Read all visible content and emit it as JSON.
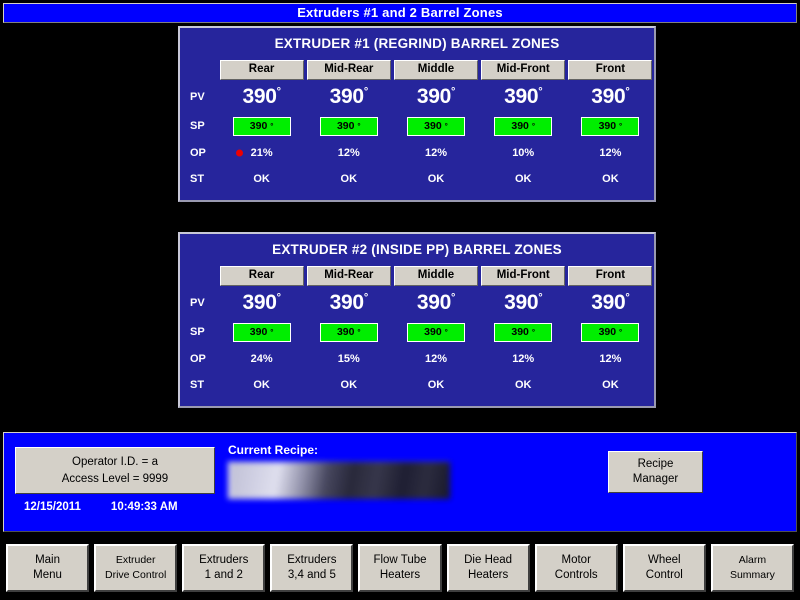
{
  "window": {
    "title": "Extruders #1 and 2 Barrel Zones",
    "title_bg": "#0000ff",
    "app_bg": "#000000",
    "panel_bg": "#26259c",
    "button_face": "#d4d0c8",
    "sp_green": "#00ee00",
    "alarm_red": "#ee0000"
  },
  "row_labels": {
    "pv": "PV",
    "sp": "SP",
    "op": "OP",
    "st": "ST"
  },
  "panels": [
    {
      "title": "EXTRUDER #1 (REGRIND) BARREL ZONES",
      "zones": [
        "Rear",
        "Mid-Rear",
        "Middle",
        "Mid-Front",
        "Front"
      ],
      "pv": [
        "390",
        "390",
        "390",
        "390",
        "390"
      ],
      "pv_unit": "°",
      "sp": [
        "390",
        "390",
        "390",
        "390",
        "390"
      ],
      "sp_unit": "°",
      "op": [
        "21%",
        "12%",
        "12%",
        "10%",
        "12%"
      ],
      "op_alarm": [
        true,
        false,
        false,
        false,
        false
      ],
      "st": [
        "OK",
        "OK",
        "OK",
        "OK",
        "OK"
      ]
    },
    {
      "title": "EXTRUDER #2 (INSIDE PP) BARREL ZONES",
      "zones": [
        "Rear",
        "Mid-Rear",
        "Middle",
        "Mid-Front",
        "Front"
      ],
      "pv": [
        "390",
        "390",
        "390",
        "390",
        "390"
      ],
      "pv_unit": "°",
      "sp": [
        "390",
        "390",
        "390",
        "390",
        "390"
      ],
      "sp_unit": "°",
      "op": [
        "24%",
        "15%",
        "12%",
        "12%",
        "12%"
      ],
      "op_alarm": [
        false,
        false,
        false,
        false,
        false
      ],
      "st": [
        "OK",
        "OK",
        "OK",
        "OK",
        "OK"
      ]
    }
  ],
  "status": {
    "operator_line": "Operator I.D. =  a",
    "access_line": "Access Level =  9999",
    "date": "12/15/2011",
    "time": "10:49:33 AM",
    "recipe_label": "Current Recipe:",
    "recipe_value": "",
    "recipe_manager_line1": "Recipe",
    "recipe_manager_line2": "Manager"
  },
  "nav": [
    {
      "line1": "Main",
      "line2": "Menu"
    },
    {
      "line1": "Extruder",
      "line2": "Drive Control"
    },
    {
      "line1": "Extruders",
      "line2": "1 and 2"
    },
    {
      "line1": "Extruders",
      "line2": "3,4 and 5"
    },
    {
      "line1": "Flow Tube",
      "line2": "Heaters"
    },
    {
      "line1": "Die Head",
      "line2": "Heaters"
    },
    {
      "line1": "Motor",
      "line2": "Controls"
    },
    {
      "line1": "Wheel",
      "line2": "Control"
    },
    {
      "line1": "Alarm",
      "line2": "Summary"
    }
  ]
}
